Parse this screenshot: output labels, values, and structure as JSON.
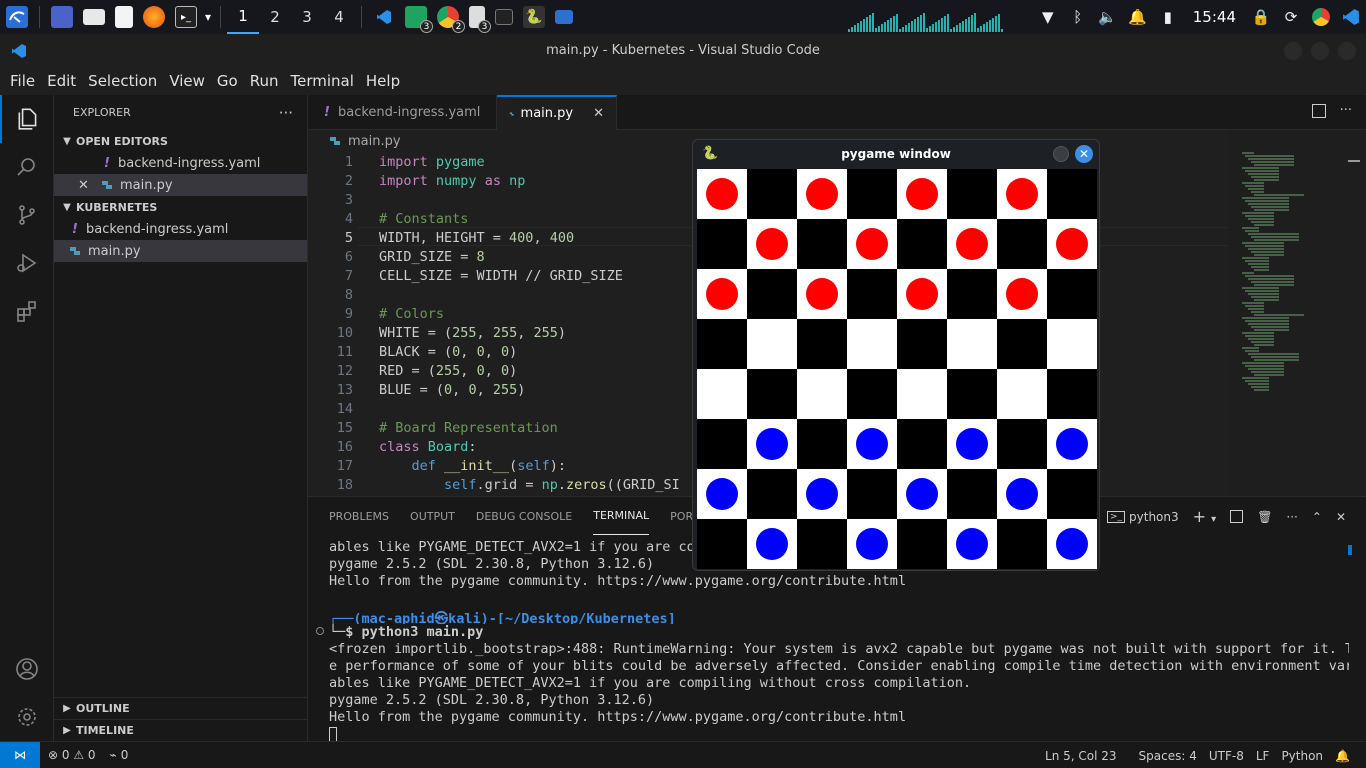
{
  "system_panel": {
    "workspaces": [
      "1",
      "2",
      "3",
      "4"
    ],
    "active_workspace": "1",
    "badges": [
      "3",
      "2",
      "3"
    ],
    "clock": "15:44"
  },
  "window": {
    "title": "main.py - Kubernetes - Visual Studio Code"
  },
  "menu": [
    "File",
    "Edit",
    "Selection",
    "View",
    "Go",
    "Run",
    "Terminal",
    "Help"
  ],
  "sidebar": {
    "title": "EXPLORER",
    "open_editors_label": "OPEN EDITORS",
    "open_editors": [
      "backend-ingress.yaml",
      "main.py"
    ],
    "folder_label": "KUBERNETES",
    "files": [
      "backend-ingress.yaml",
      "main.py"
    ],
    "outline_label": "OUTLINE",
    "timeline_label": "TIMELINE"
  },
  "tabs": [
    "backend-ingress.yaml",
    "main.py"
  ],
  "breadcrumb": "main.py",
  "code_lines": [
    {
      "n": "1",
      "text": "import pygame"
    },
    {
      "n": "2",
      "text": "import numpy as np"
    },
    {
      "n": "3",
      "text": ""
    },
    {
      "n": "4",
      "text": "# Constants"
    },
    {
      "n": "5",
      "text": "WIDTH, HEIGHT = 400, 400"
    },
    {
      "n": "6",
      "text": "GRID_SIZE = 8"
    },
    {
      "n": "7",
      "text": "CELL_SIZE = WIDTH // GRID_SIZE"
    },
    {
      "n": "8",
      "text": ""
    },
    {
      "n": "9",
      "text": "# Colors"
    },
    {
      "n": "10",
      "text": "WHITE = (255, 255, 255)"
    },
    {
      "n": "11",
      "text": "BLACK = (0, 0, 0)"
    },
    {
      "n": "12",
      "text": "RED = (255, 0, 0)"
    },
    {
      "n": "13",
      "text": "BLUE = (0, 0, 255)"
    },
    {
      "n": "14",
      "text": ""
    },
    {
      "n": "15",
      "text": "# Board Representation"
    },
    {
      "n": "16",
      "text": "class Board:"
    },
    {
      "n": "17",
      "text": "    def __init__(self):"
    },
    {
      "n": "18",
      "text": "        self.grid = np.zeros((GRID_SI"
    }
  ],
  "panel": {
    "tabs": [
      "PROBLEMS",
      "OUTPUT",
      "DEBUG CONSOLE",
      "TERMINAL",
      "PORT"
    ],
    "active_tab": "TERMINAL",
    "terminal_name": "python3",
    "terminal_lines": [
      "ables like PYGAME_DETECT_AVX2=1 if you are co",
      "pygame 2.5.2 (SDL 2.30.8, Python 3.12.6)",
      "Hello from the pygame community. https://www.pygame.org/contribute.html",
      "",
      "┌──(mac-aphid㉿kali)-[~/Desktop/Kubernetes]",
      "└─$ python3 main.py",
      "<frozen importlib._bootstrap>:488: RuntimeWarning: Your system is avx2 capable but pygame was not built with support for it. Th",
      "e performance of some of your blits could be adversely affected. Consider enabling compile time detection with environment vari",
      "ables like PYGAME_DETECT_AVX2=1 if you are compiling without cross compilation.",
      "pygame 2.5.2 (SDL 2.30.8, Python 3.12.6)",
      "Hello from the pygame community. https://www.pygame.org/contribute.html"
    ]
  },
  "statusbar": {
    "problems": "⊗ 0 ⚠ 0",
    "ports": "0",
    "position": "Ln 5, Col 23",
    "spaces": "Spaces: 4",
    "encoding": "UTF-8",
    "eol": "LF",
    "language": "Python"
  },
  "pygame": {
    "title": "pygame window",
    "colors": {
      "light": "#ffffff",
      "dark": "#000000",
      "red": "#ff0000",
      "blue": "#0000ff"
    },
    "board": [
      "R.R.R.R.",
      ".R.R.R.R",
      "R.R.R.R.",
      "........",
      "........",
      ".B.B.B.B",
      "B.B.B.B.",
      ".B.B.B.B"
    ]
  }
}
